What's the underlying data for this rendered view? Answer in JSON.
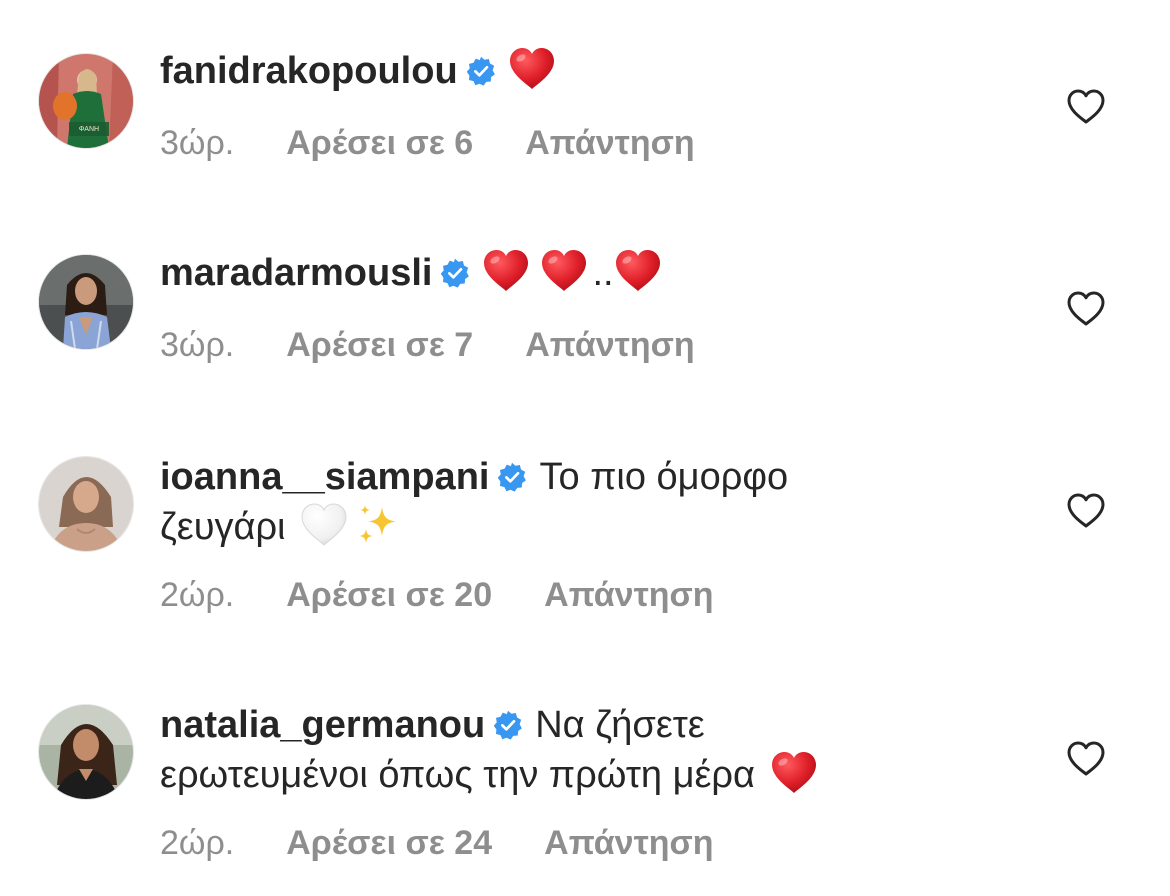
{
  "comments": [
    {
      "username": "fanidrakopoulou",
      "text": "",
      "emojis": [
        "red-heart"
      ],
      "time": "3ώρ.",
      "likes": "Αρέσει σε 6",
      "reply": "Απάντηση",
      "avatar_label": "ΦΑΝΗ"
    },
    {
      "username": "maradarmousli",
      "text": "",
      "emojis": [
        "red-heart",
        "red-heart",
        "red-heart"
      ],
      "dots": "..",
      "time": "3ώρ.",
      "likes": "Αρέσει σε 7",
      "reply": "Απάντηση"
    },
    {
      "username": "ioanna__siampani",
      "text": "Το πιο όμορφο",
      "text2": "ζευγάρι",
      "emojis": [
        "white-heart",
        "sparkles"
      ],
      "time": "2ώρ.",
      "likes": "Αρέσει σε 20",
      "reply": "Απάντηση"
    },
    {
      "username": "natalia_germanou",
      "text": "Να ζήσετε",
      "text2": "ερωτευμένοι όπως την πρώτη μέρα",
      "emojis": [
        "red-heart"
      ],
      "time": "2ώρ.",
      "likes": "Αρέσει σε 24",
      "reply": "Απάντηση"
    }
  ],
  "colors": {
    "verified": "#3897f0",
    "meta": "#8e8e8e",
    "text": "#262626",
    "heart": "#e0202a"
  }
}
